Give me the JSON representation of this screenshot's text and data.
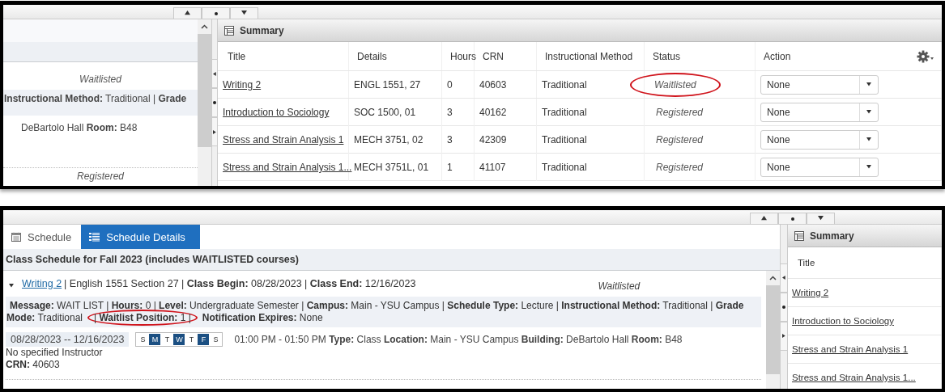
{
  "top_view": {
    "left_pane": {
      "status": "Waitlisted",
      "detail_line": "**Instructional Method:** Traditional | **Grade**",
      "location_line": "DeBartolo Hall **Room:** B48",
      "next_status": "Registered"
    },
    "summary": {
      "title": "Summary",
      "columns": [
        "Title",
        "Details",
        "Hours",
        "CRN",
        "Instructional Method",
        "Status",
        "Action"
      ],
      "rows": [
        {
          "title": "Writing 2",
          "details": "ENGL 1551, 27",
          "hours": "0",
          "crn": "40603",
          "method": "Traditional",
          "status": "Waitlisted",
          "circled": true,
          "action": "None"
        },
        {
          "title": "Introduction to Sociology",
          "details": "SOC 1500, 01",
          "hours": "3",
          "crn": "40162",
          "method": "Traditional",
          "status": "Registered",
          "circled": false,
          "action": "None"
        },
        {
          "title": "Stress and Strain Analysis 1",
          "details": "MECH 3751, 02",
          "hours": "3",
          "crn": "42309",
          "method": "Traditional",
          "status": "Registered",
          "circled": false,
          "action": "None"
        },
        {
          "title": "Stress and Strain Analysis 1...",
          "details": "MECH 3751L, 01",
          "hours": "1",
          "crn": "41107",
          "method": "Traditional",
          "status": "Registered",
          "circled": false,
          "action": "None"
        }
      ]
    }
  },
  "bottom_view": {
    "tabs": [
      {
        "label": "Schedule",
        "selected": false
      },
      {
        "label": "Schedule Details",
        "selected": true
      }
    ],
    "heading": "Class Schedule for Fall 2023 (includes WAITLISTED courses)",
    "course": {
      "title": "Writing 2",
      "summary": "| English 1551 Section 27 | **Class Begin:** 08/28/2023 | **Class End:** 12/16/2023",
      "status": "Waitlisted",
      "expanded": true,
      "message": [
        {
          "text": "**Message:** WAIT LIST | **Hours:** 0 | **Level:** Undergraduate Semester | **Campus:** Main - YSU Campus | **Schedule Type:** Lecture | **Instructional Method:** Traditional | **Grade Mode:** Traditional",
          "circled": false
        },
        {
          "text": "| **Waitlist Position:** 1 |",
          "circled": true
        },
        {
          "text": "**Notification Expires:** None",
          "circled": false
        }
      ],
      "date_range": "08/28/2023 -- 12/16/2023",
      "days": [
        {
          "label": "S",
          "on": false
        },
        {
          "label": "M",
          "on": true
        },
        {
          "label": "T",
          "on": false
        },
        {
          "label": "W",
          "on": true
        },
        {
          "label": "T",
          "on": false
        },
        {
          "label": "F",
          "on": true
        },
        {
          "label": "S",
          "on": false
        }
      ],
      "meeting": "01:00 PM - 01:50 PM **Type:** Class **Location:** Main - YSU Campus **Building:** DeBartolo Hall **Room:** B48",
      "instructor": "No specified Instructor",
      "crn": "**CRN:** 40603"
    },
    "summary": {
      "title": "Summary",
      "columns": [
        "Title"
      ],
      "rows": [
        {
          "title": "Writing 2"
        },
        {
          "title": "Introduction to Sociology"
        },
        {
          "title": "Stress and Strain Analysis 1"
        },
        {
          "title": "Stress and Strain Analysis 1..."
        }
      ]
    }
  }
}
